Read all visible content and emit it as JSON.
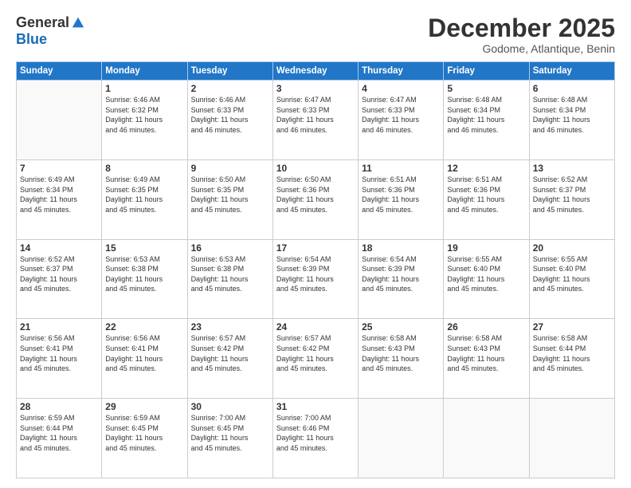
{
  "logo": {
    "general": "General",
    "blue": "Blue"
  },
  "title": "December 2025",
  "subtitle": "Godome, Atlantique, Benin",
  "days_header": [
    "Sunday",
    "Monday",
    "Tuesday",
    "Wednesday",
    "Thursday",
    "Friday",
    "Saturday"
  ],
  "weeks": [
    [
      {
        "day": "",
        "info": ""
      },
      {
        "day": "1",
        "info": "Sunrise: 6:46 AM\nSunset: 6:32 PM\nDaylight: 11 hours\nand 46 minutes."
      },
      {
        "day": "2",
        "info": "Sunrise: 6:46 AM\nSunset: 6:33 PM\nDaylight: 11 hours\nand 46 minutes."
      },
      {
        "day": "3",
        "info": "Sunrise: 6:47 AM\nSunset: 6:33 PM\nDaylight: 11 hours\nand 46 minutes."
      },
      {
        "day": "4",
        "info": "Sunrise: 6:47 AM\nSunset: 6:33 PM\nDaylight: 11 hours\nand 46 minutes."
      },
      {
        "day": "5",
        "info": "Sunrise: 6:48 AM\nSunset: 6:34 PM\nDaylight: 11 hours\nand 46 minutes."
      },
      {
        "day": "6",
        "info": "Sunrise: 6:48 AM\nSunset: 6:34 PM\nDaylight: 11 hours\nand 46 minutes."
      }
    ],
    [
      {
        "day": "7",
        "info": "Sunrise: 6:49 AM\nSunset: 6:34 PM\nDaylight: 11 hours\nand 45 minutes."
      },
      {
        "day": "8",
        "info": "Sunrise: 6:49 AM\nSunset: 6:35 PM\nDaylight: 11 hours\nand 45 minutes."
      },
      {
        "day": "9",
        "info": "Sunrise: 6:50 AM\nSunset: 6:35 PM\nDaylight: 11 hours\nand 45 minutes."
      },
      {
        "day": "10",
        "info": "Sunrise: 6:50 AM\nSunset: 6:36 PM\nDaylight: 11 hours\nand 45 minutes."
      },
      {
        "day": "11",
        "info": "Sunrise: 6:51 AM\nSunset: 6:36 PM\nDaylight: 11 hours\nand 45 minutes."
      },
      {
        "day": "12",
        "info": "Sunrise: 6:51 AM\nSunset: 6:36 PM\nDaylight: 11 hours\nand 45 minutes."
      },
      {
        "day": "13",
        "info": "Sunrise: 6:52 AM\nSunset: 6:37 PM\nDaylight: 11 hours\nand 45 minutes."
      }
    ],
    [
      {
        "day": "14",
        "info": "Sunrise: 6:52 AM\nSunset: 6:37 PM\nDaylight: 11 hours\nand 45 minutes."
      },
      {
        "day": "15",
        "info": "Sunrise: 6:53 AM\nSunset: 6:38 PM\nDaylight: 11 hours\nand 45 minutes."
      },
      {
        "day": "16",
        "info": "Sunrise: 6:53 AM\nSunset: 6:38 PM\nDaylight: 11 hours\nand 45 minutes."
      },
      {
        "day": "17",
        "info": "Sunrise: 6:54 AM\nSunset: 6:39 PM\nDaylight: 11 hours\nand 45 minutes."
      },
      {
        "day": "18",
        "info": "Sunrise: 6:54 AM\nSunset: 6:39 PM\nDaylight: 11 hours\nand 45 minutes."
      },
      {
        "day": "19",
        "info": "Sunrise: 6:55 AM\nSunset: 6:40 PM\nDaylight: 11 hours\nand 45 minutes."
      },
      {
        "day": "20",
        "info": "Sunrise: 6:55 AM\nSunset: 6:40 PM\nDaylight: 11 hours\nand 45 minutes."
      }
    ],
    [
      {
        "day": "21",
        "info": "Sunrise: 6:56 AM\nSunset: 6:41 PM\nDaylight: 11 hours\nand 45 minutes."
      },
      {
        "day": "22",
        "info": "Sunrise: 6:56 AM\nSunset: 6:41 PM\nDaylight: 11 hours\nand 45 minutes."
      },
      {
        "day": "23",
        "info": "Sunrise: 6:57 AM\nSunset: 6:42 PM\nDaylight: 11 hours\nand 45 minutes."
      },
      {
        "day": "24",
        "info": "Sunrise: 6:57 AM\nSunset: 6:42 PM\nDaylight: 11 hours\nand 45 minutes."
      },
      {
        "day": "25",
        "info": "Sunrise: 6:58 AM\nSunset: 6:43 PM\nDaylight: 11 hours\nand 45 minutes."
      },
      {
        "day": "26",
        "info": "Sunrise: 6:58 AM\nSunset: 6:43 PM\nDaylight: 11 hours\nand 45 minutes."
      },
      {
        "day": "27",
        "info": "Sunrise: 6:58 AM\nSunset: 6:44 PM\nDaylight: 11 hours\nand 45 minutes."
      }
    ],
    [
      {
        "day": "28",
        "info": "Sunrise: 6:59 AM\nSunset: 6:44 PM\nDaylight: 11 hours\nand 45 minutes."
      },
      {
        "day": "29",
        "info": "Sunrise: 6:59 AM\nSunset: 6:45 PM\nDaylight: 11 hours\nand 45 minutes."
      },
      {
        "day": "30",
        "info": "Sunrise: 7:00 AM\nSunset: 6:45 PM\nDaylight: 11 hours\nand 45 minutes."
      },
      {
        "day": "31",
        "info": "Sunrise: 7:00 AM\nSunset: 6:46 PM\nDaylight: 11 hours\nand 45 minutes."
      },
      {
        "day": "",
        "info": ""
      },
      {
        "day": "",
        "info": ""
      },
      {
        "day": "",
        "info": ""
      }
    ]
  ]
}
